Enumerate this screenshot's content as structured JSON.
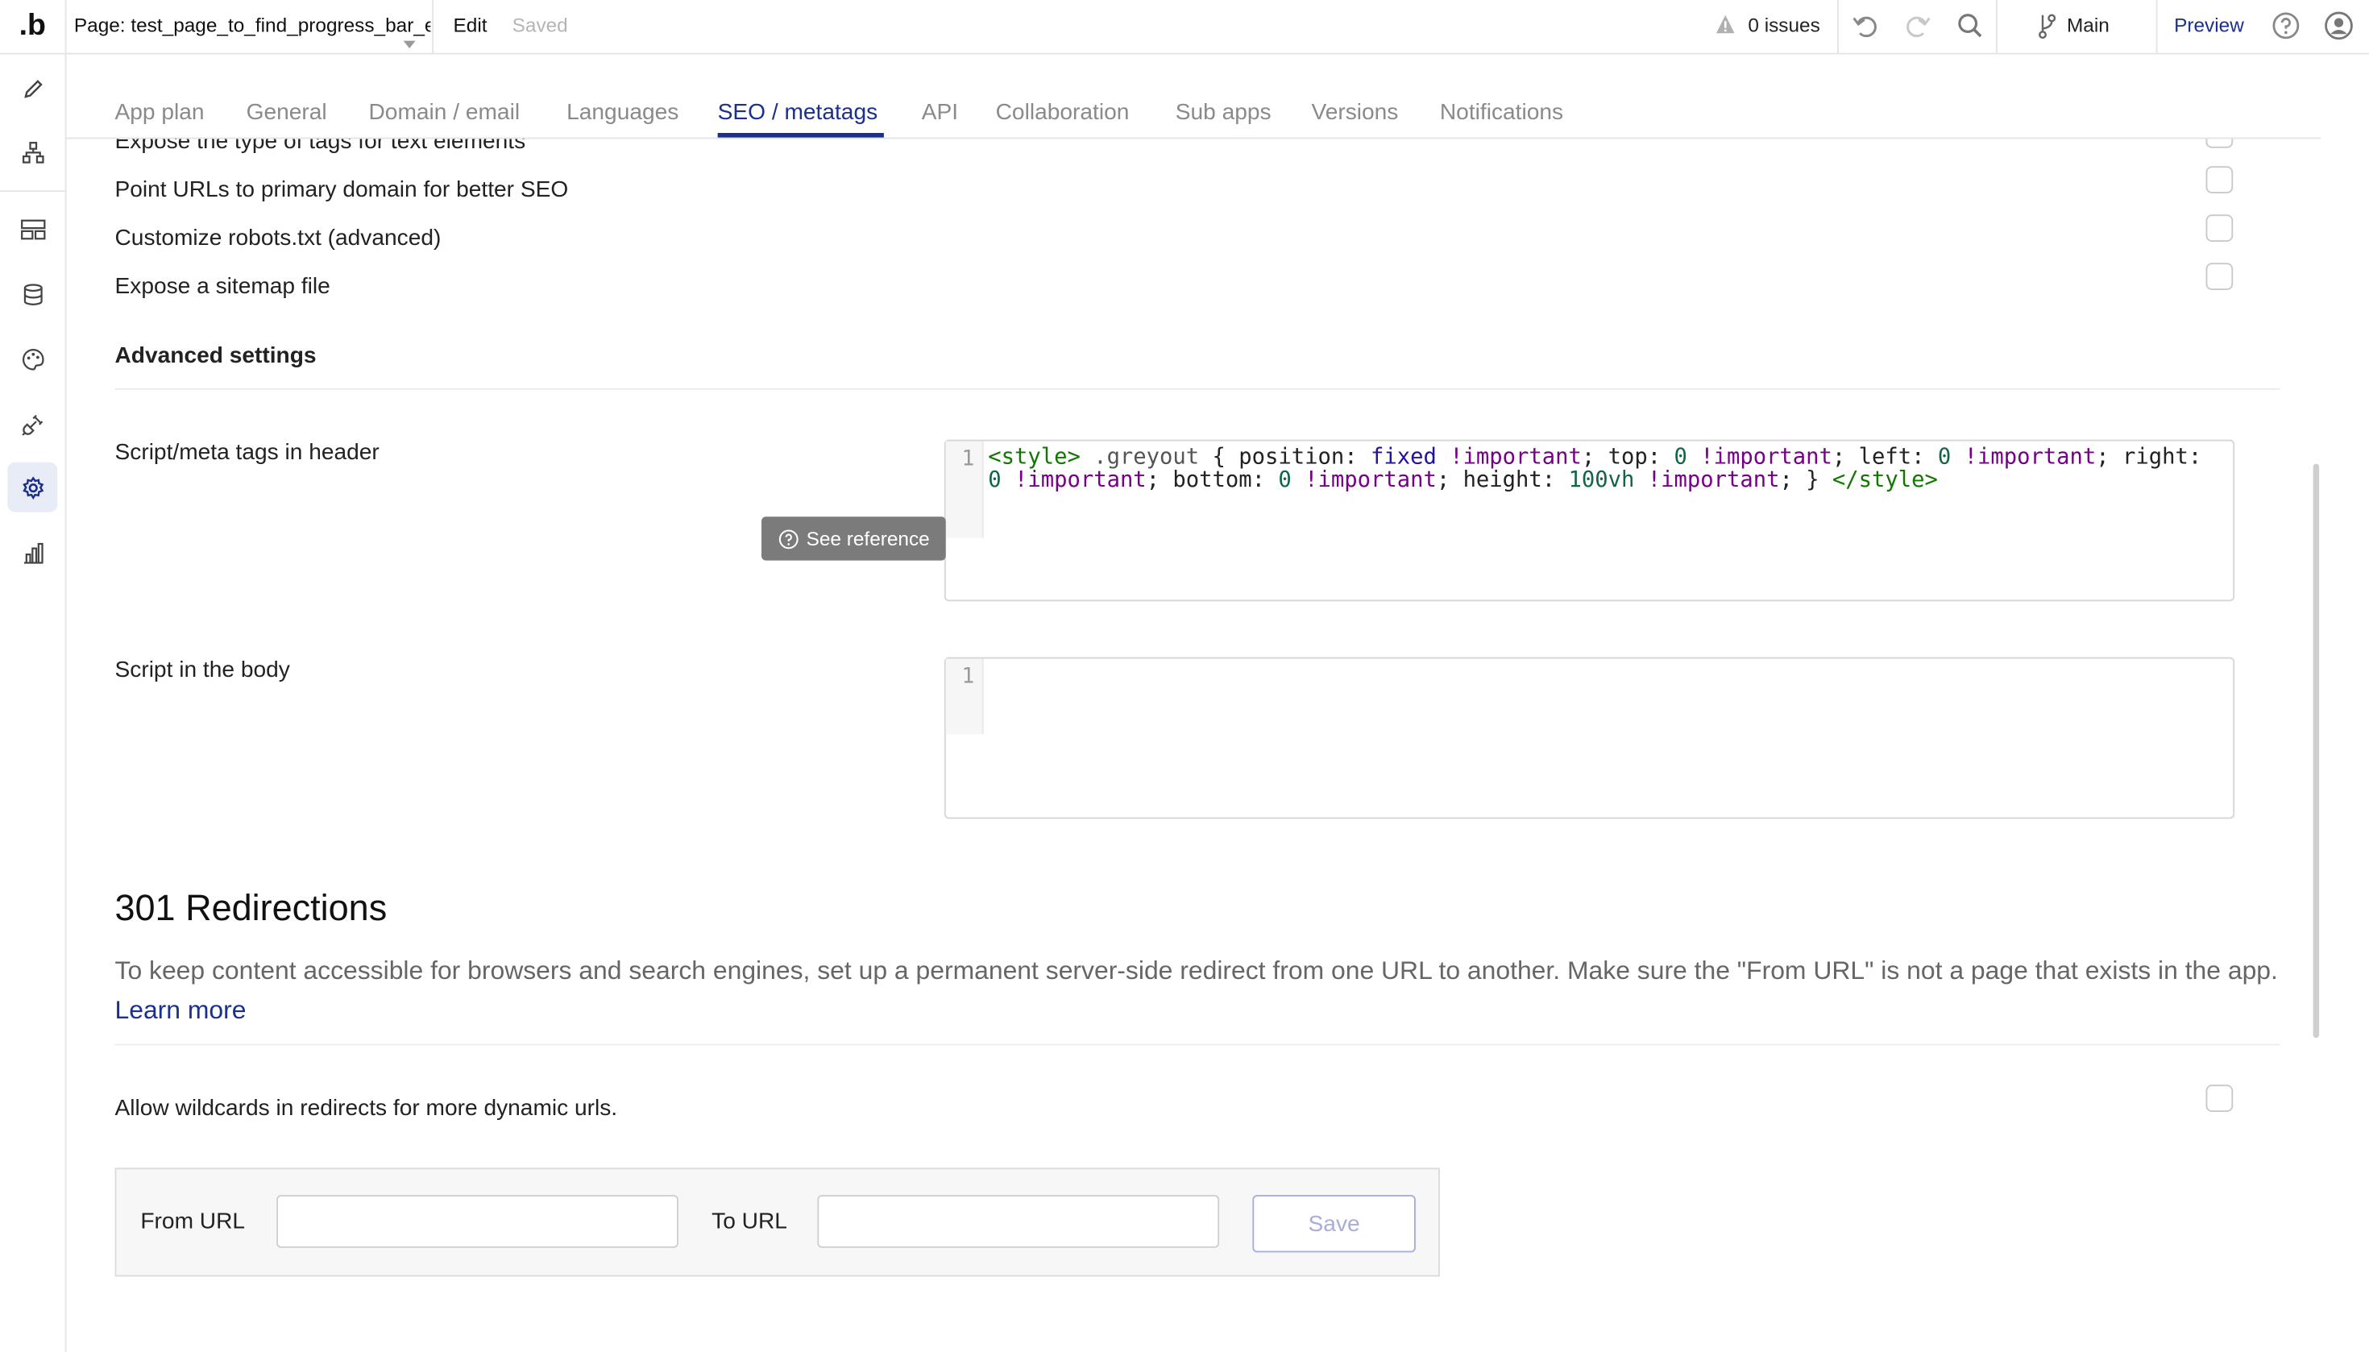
{
  "topbar": {
    "page_selector": "Page: test_page_to_find_progress_bar_e",
    "edit_label": "Edit",
    "status": "Saved",
    "issues": "0 issues",
    "branch": "Main",
    "preview": "Preview"
  },
  "tabs": [
    {
      "label": "App plan"
    },
    {
      "label": "General"
    },
    {
      "label": "Domain / email"
    },
    {
      "label": "Languages"
    },
    {
      "label": "SEO / metatags"
    },
    {
      "label": "API"
    },
    {
      "label": "Collaboration"
    },
    {
      "label": "Sub apps"
    },
    {
      "label": "Versions"
    },
    {
      "label": "Notifications"
    }
  ],
  "active_tab": "SEO / metatags",
  "settings": [
    {
      "label": "Expose the type of tags for text elements"
    },
    {
      "label": "Point URLs to primary domain for better SEO"
    },
    {
      "label": "Customize robots.txt (advanced)"
    },
    {
      "label": "Expose a sitemap file"
    }
  ],
  "advanced": {
    "heading": "Advanced settings",
    "header_script_label": "Script/meta tags in header",
    "header_line_number": "1",
    "see_reference": "See reference",
    "body_script_label": "Script in the body",
    "body_line_number": "1"
  },
  "header_code": {
    "t1": "<style>",
    "t2": " .greyout",
    "t3": " { position: ",
    "t4": "fixed",
    "t5": " !important",
    "t6": "; top: ",
    "t7": "0",
    "t8": " !important",
    "t9": "; left: ",
    "t10": "0",
    "t11": " !important",
    "t12": "; right: ",
    "t13": "0",
    "t14": " !important",
    "t15": "; bottom: ",
    "t16": "0",
    "t17": " !important",
    "t18": "; height: ",
    "t19": "100vh",
    "t20": " !important",
    "t21": "; } ",
    "t22": "</style>"
  },
  "redirections": {
    "heading": "301 Redirections",
    "description": "To keep content accessible for browsers and search engines, set up a permanent server-side redirect from one URL to another. Make sure the \"From URL\" is not a page that exists in the app.",
    "learn_more": "Learn more",
    "wildcards_label": "Allow wildcards in redirects for more dynamic urls.",
    "from_label": "From URL",
    "from_value": "",
    "to_label": "To URL",
    "to_value": "",
    "save_label": "Save"
  },
  "colors": {
    "accent": "#1b2f8f",
    "save_disabled": "#a7ade0",
    "tooltip_bg": "#7b7b7b"
  }
}
